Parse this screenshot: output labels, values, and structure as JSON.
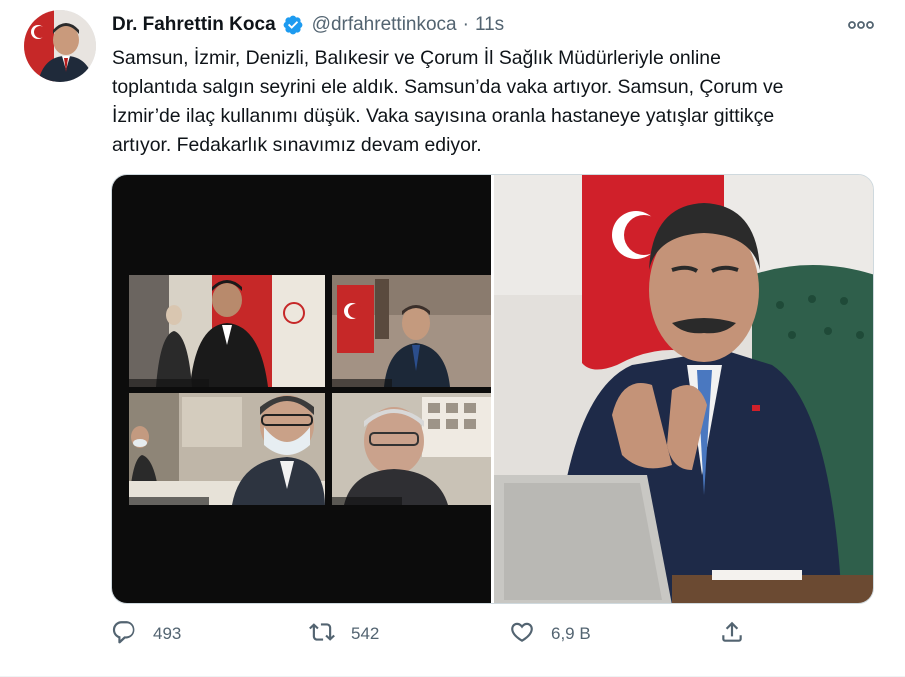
{
  "author": {
    "display_name": "Dr. Fahrettin Koca",
    "handle": "@drfahrettinkoca",
    "separator": "·",
    "time": "11s",
    "verified": true
  },
  "tweet": {
    "text": "Samsun, İzmir, Denizli, Balıkesir ve Çorum İl Sağlık Müdürleriyle online\ntoplantıda salgın seyrini ele aldık. Samsun’da vaka artıyor. Samsun, Çorum ve\nİzmir’de ilaç kullanımı düşük. Vaka sayısına oranla hastaneye yatışlar gittikçe\nartıyor. Fedakarlık sınavımız devam ediyor."
  },
  "actions": {
    "reply_count": "493",
    "retweet_count": "542",
    "like_count": "6,9 B"
  },
  "icons": {
    "verified": "verified-badge-icon",
    "more": "more-options-icon",
    "reply": "reply-icon",
    "retweet": "retweet-icon",
    "like": "like-icon",
    "share": "share-icon"
  },
  "colors": {
    "text": "#0f1419",
    "secondary_text": "#536471",
    "verified_blue": "#1d9bf0",
    "border": "#cfd9de"
  }
}
